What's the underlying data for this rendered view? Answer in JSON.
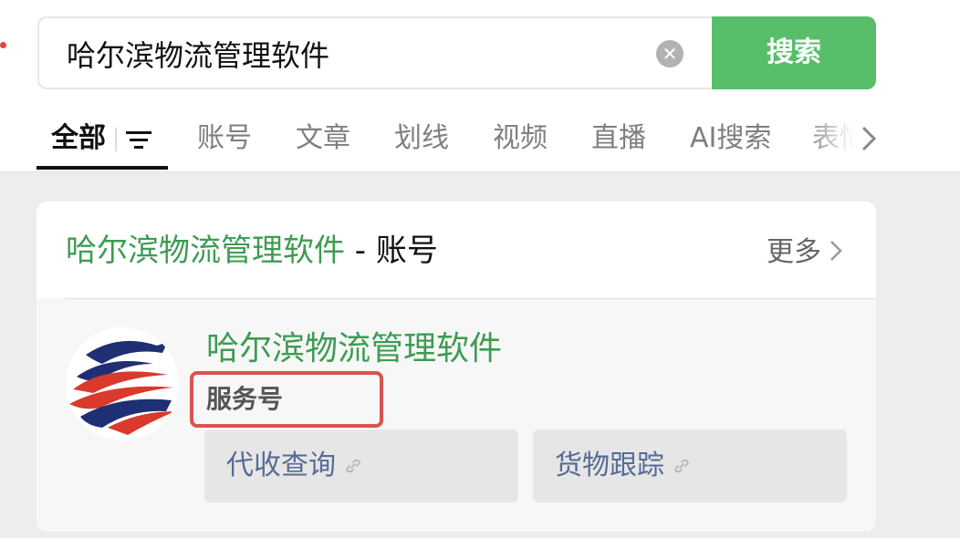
{
  "search": {
    "query": "哈尔滨物流管理软件",
    "button_label": "搜索"
  },
  "tabs": [
    {
      "label": "全部",
      "active": true
    },
    {
      "label": "账号"
    },
    {
      "label": "文章"
    },
    {
      "label": "划线"
    },
    {
      "label": "视频"
    },
    {
      "label": "直播"
    },
    {
      "label": "AI搜索"
    },
    {
      "label": "表情"
    }
  ],
  "section": {
    "title_keyword": "哈尔滨物流管理软件",
    "title_suffix": " - 账号",
    "more_label": "更多"
  },
  "account": {
    "name": "哈尔滨物流管理软件",
    "type": "服务号",
    "services": [
      {
        "label": "代收查询"
      },
      {
        "label": "货物跟踪"
      }
    ]
  },
  "colors": {
    "accent_green": "#57be6a",
    "keyword_green": "#3d9c52",
    "link_blue": "#576b95",
    "highlight_red": "#d9534f"
  },
  "icons": [
    "clear-icon",
    "filter-icon",
    "chevron-right-icon",
    "link-icon"
  ]
}
